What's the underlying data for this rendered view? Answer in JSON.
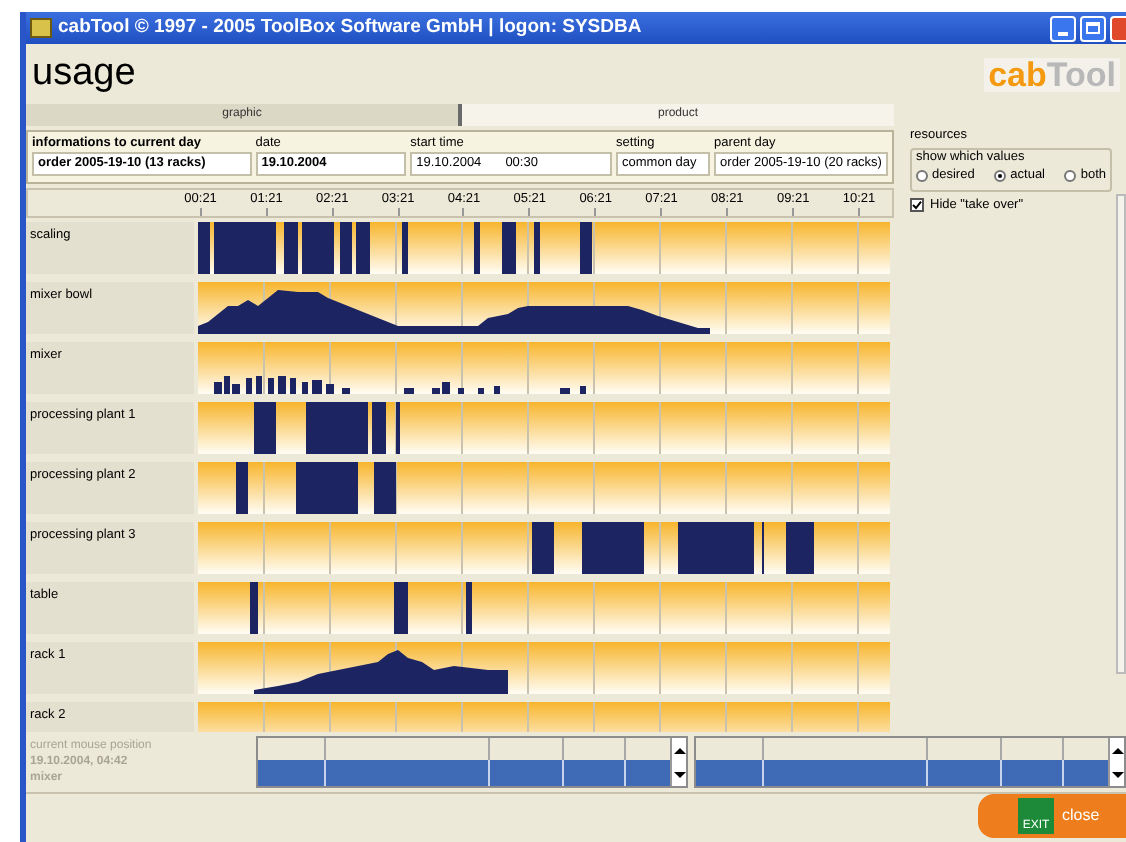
{
  "window": {
    "title": "cabTool © 1997 - 2005 ToolBox Software GmbH | logon: SYSDBA"
  },
  "header": {
    "title": "usage",
    "logo_first": "cab",
    "logo_second": "Tool"
  },
  "tabs": [
    {
      "label": "graphic",
      "selected": true
    },
    {
      "label": "product",
      "selected": false
    }
  ],
  "info": {
    "heading": "informations to current day",
    "order": "order 2005-19-10  (13 racks)",
    "date_label": "date",
    "date": "19.10.2004",
    "start_label": "start time",
    "start_date": "19.10.2004",
    "start_time": "00:30",
    "setting_label": "setting",
    "setting": "common day",
    "parent_label": "parent day",
    "parent": "order 2005-19-10  (20 racks)"
  },
  "resources": {
    "title": "resources",
    "group_label": "show which values",
    "options": [
      {
        "label": "desired",
        "selected": false
      },
      {
        "label": "actual",
        "selected": true
      },
      {
        "label": "both",
        "selected": false
      }
    ],
    "hide_take_over": {
      "label": "Hide \"take over\"",
      "checked": true
    }
  },
  "time_ticks": [
    "00:21",
    "01:21",
    "02:21",
    "03:21",
    "04:21",
    "05:21",
    "06:21",
    "07:21",
    "08:21",
    "09:21",
    "10:21"
  ],
  "rows": [
    {
      "label": "scaling"
    },
    {
      "label": "mixer bowl"
    },
    {
      "label": "mixer"
    },
    {
      "label": "processing plant 1"
    },
    {
      "label": "processing plant 2"
    },
    {
      "label": "processing plant 3"
    },
    {
      "label": "table"
    },
    {
      "label": "rack 1"
    },
    {
      "label": "rack 2"
    }
  ],
  "status": {
    "title": "current mouse position",
    "time": "19.10.2004, 04:42",
    "resource": "mixer"
  },
  "close_button": {
    "sign": "EXIT",
    "label": "close"
  }
}
